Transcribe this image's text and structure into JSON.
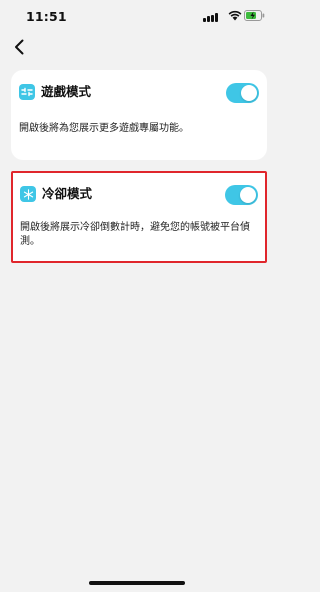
{
  "status_bar": {
    "time": "11:51"
  },
  "navigation": {
    "back_icon": "chevron-left-icon"
  },
  "settings": [
    {
      "id": "game-mode",
      "icon": "sliders-icon",
      "title": "遊戲模式",
      "description": "開啟後將為您展示更多遊戲專屬功能。",
      "enabled": true
    },
    {
      "id": "cooldown-mode",
      "icon": "snowflake-icon",
      "title": "冷卻模式",
      "description": "開啟後將展示冷卻倒數計時，避免您的帳號被平台偵測。",
      "enabled": true
    }
  ],
  "colors": {
    "accent": "#3fc6e6",
    "highlight_border": "#e0262c",
    "background": "#f2f2f2"
  }
}
